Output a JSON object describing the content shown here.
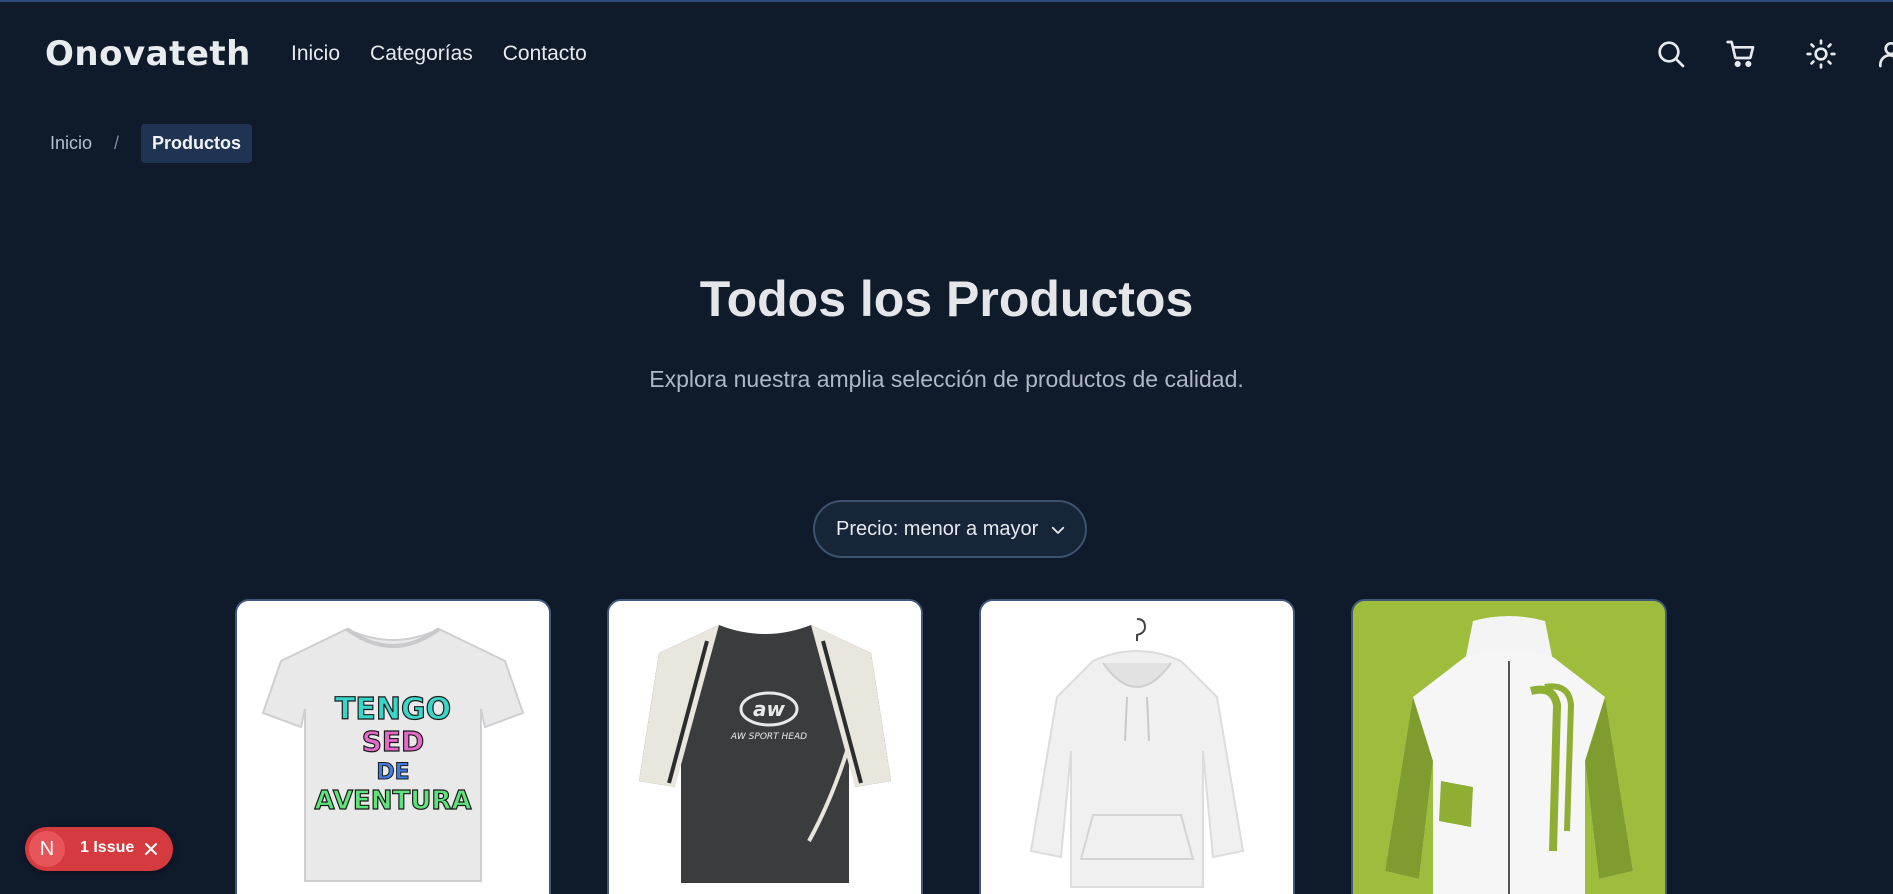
{
  "header": {
    "logo": "Onovateth",
    "nav": [
      "Inicio",
      "Categorías",
      "Contacto"
    ],
    "icons": [
      "search-icon",
      "cart-icon",
      "sun-icon",
      "user-icon"
    ]
  },
  "breadcrumb": {
    "home": "Inicio",
    "separator": "/",
    "current": "Productos"
  },
  "main": {
    "title": "Todos los Productos",
    "subtitle": "Explora nuestra amplia selección de productos de calidad.",
    "sort": {
      "selected": "Precio: menor a mayor"
    }
  },
  "products": [
    {
      "image": "white-tshirt-tengo-sed-de-aventura",
      "print_lines": [
        "TENGO",
        "SED",
        "DE",
        "AVENTURA"
      ]
    },
    {
      "image": "black-sport-tshirt-aw",
      "print_logo": "aw",
      "print_text": "AW SPORT HEAD"
    },
    {
      "image": "white-hoodie-on-hanger"
    },
    {
      "image": "white-green-windbreaker-jacket"
    }
  ],
  "dev_overlay": {
    "letter": "N",
    "label": "1 Issue"
  },
  "colors": {
    "background": "#0f1a2b",
    "breadcrumb_current_bg": "#1e3452",
    "issue_badge": "#d53a3e"
  }
}
